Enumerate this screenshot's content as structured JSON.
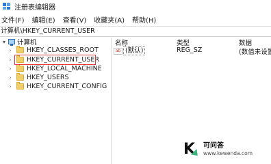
{
  "window": {
    "title": "注册表编辑器"
  },
  "menu": [
    "文件(F)",
    "编辑(E)",
    "查看(V)",
    "收藏夹(A)",
    "帮助(H)"
  ],
  "address": "计算机\\HKEY_CURRENT_USER",
  "tree": {
    "root": "计算机",
    "items": [
      {
        "label": "HKEY_CLASSES_ROOT",
        "expander": "chevron-right"
      },
      {
        "label": "HKEY_CURRENT_USER",
        "expander": "chevron-right",
        "selected": true
      },
      {
        "label": "HKEY_LOCAL_MACHINE",
        "expander": "chevron-right"
      },
      {
        "label": "HKEY_USERS",
        "expander": "chevron-right"
      },
      {
        "label": "HKEY_CURRENT_CONFIG",
        "expander": "chevron-right"
      }
    ]
  },
  "values": {
    "columns": {
      "name": "名称",
      "type": "类型",
      "data": "数据"
    },
    "rows": [
      {
        "icon": "ab",
        "name": "(默认)",
        "type": "REG_SZ",
        "data": "(数值未设置)"
      }
    ]
  },
  "watermark": {
    "logo": "K",
    "name": "可问答",
    "url": "www.kewenda.com"
  },
  "colors": {
    "selection_box": "#e0393e",
    "folder": "#f1cf68"
  }
}
